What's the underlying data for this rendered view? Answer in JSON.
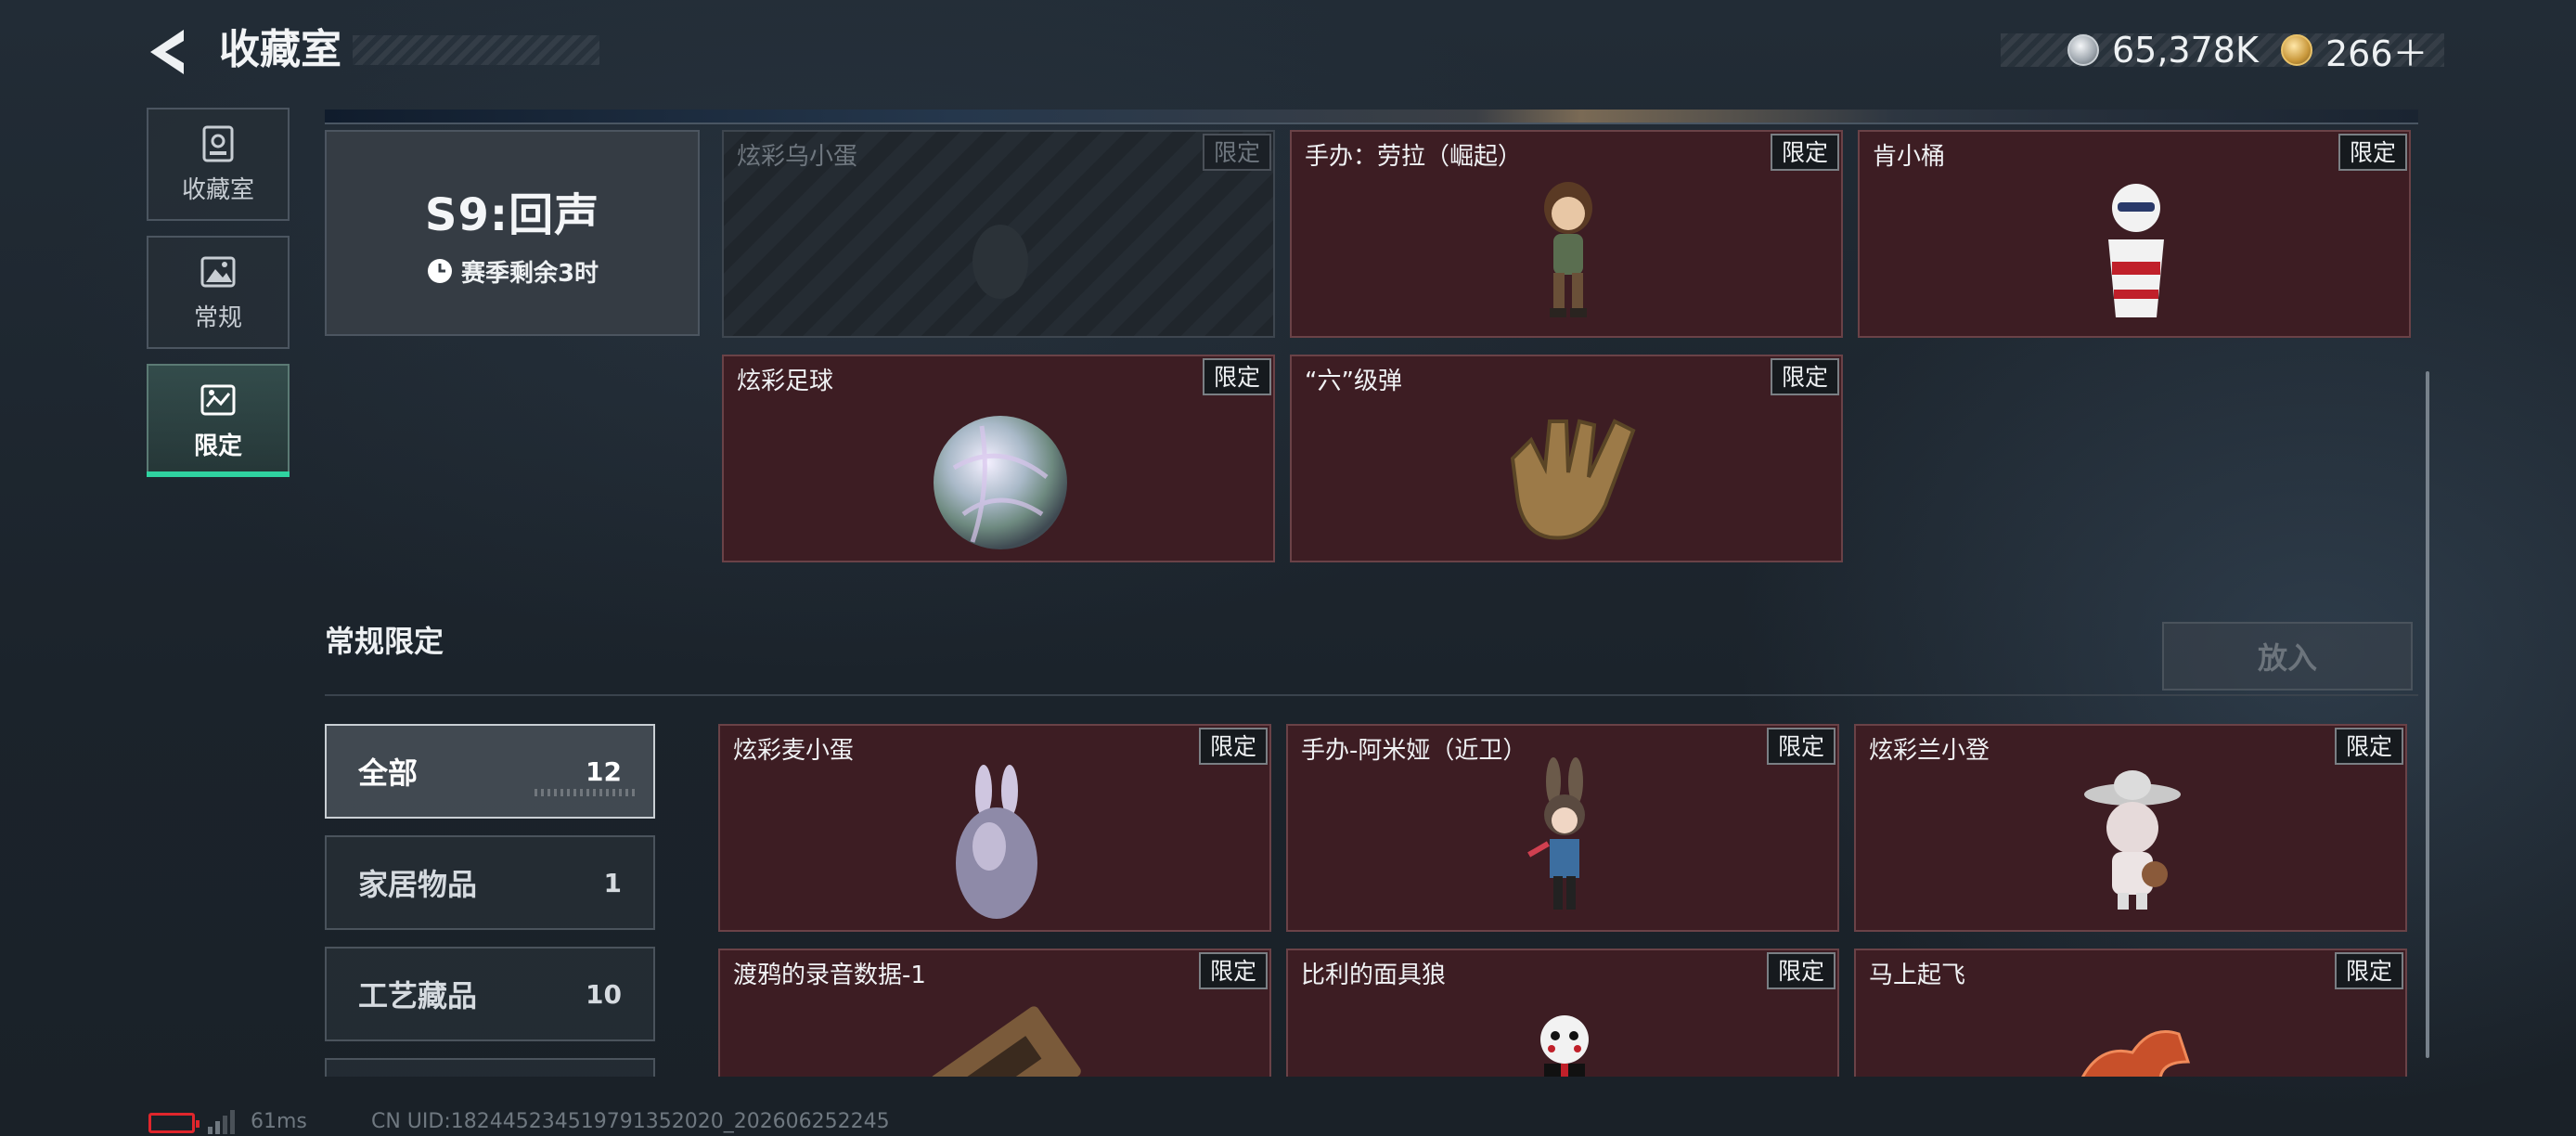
{
  "header": {
    "title": "收藏室",
    "silver_amount": "65,378K",
    "gold_amount": "266＋"
  },
  "sidebar": {
    "items": [
      {
        "label": "收藏室",
        "icon": "collection-icon"
      },
      {
        "label": "常规",
        "icon": "image-icon"
      },
      {
        "label": "限定",
        "icon": "limited-icon",
        "active": true
      }
    ]
  },
  "season": {
    "title": "S9:回声",
    "remaining": "赛季剩余3时"
  },
  "season_items": [
    {
      "name": "炫彩乌小蛋",
      "badge": "限定",
      "state": "not-owned"
    },
    {
      "name": "手办：劳拉（崛起）",
      "badge": "限定"
    },
    {
      "name": "肯小桶",
      "badge": "限定"
    },
    {
      "name": "炫彩足球",
      "badge": "限定"
    },
    {
      "name": "“六”级弹",
      "badge": "限定"
    }
  ],
  "section": {
    "title": "常规限定",
    "put_button": "放入"
  },
  "filters": [
    {
      "label": "全部",
      "count": "12",
      "active": true
    },
    {
      "label": "家居物品",
      "count": "1"
    },
    {
      "label": "工艺藏品",
      "count": "10"
    }
  ],
  "regular_items": [
    {
      "name": "炫彩麦小蛋",
      "badge": "限定"
    },
    {
      "name": "手办-阿米娅（近卫）",
      "badge": "限定"
    },
    {
      "name": "炫彩兰小登",
      "badge": "限定"
    },
    {
      "name": "渡鸦的录音数据-1",
      "badge": "限定"
    },
    {
      "name": "比利的面具狼",
      "badge": "限定"
    },
    {
      "name": "马上起飞",
      "badge": "限定"
    }
  ],
  "status": {
    "ping": "61ms",
    "uid": "CN UID:182445234519791352020_202606252245"
  },
  "colors": {
    "accent": "#2fd2a0",
    "card_bg": "#3d1d23",
    "battery": "#e0262c"
  }
}
